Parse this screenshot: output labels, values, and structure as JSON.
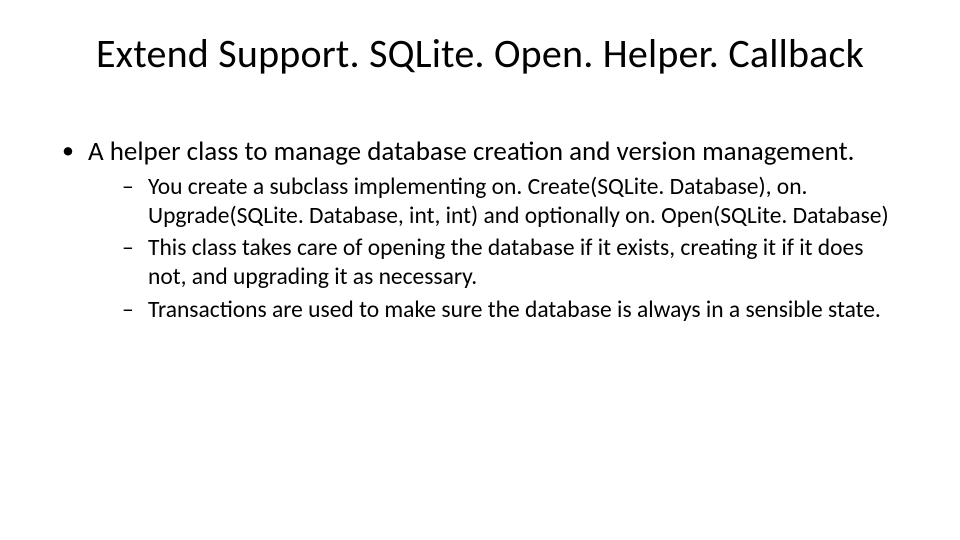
{
  "title": "Extend Support. SQLite. Open. Helper. Callback",
  "level1_text": "A helper class to manage database creation and version management.",
  "sub": [
    "You create a subclass implementing on. Create(SQLite. Database), on. Upgrade(SQLite. Database, int, int) and optionally on. Open(SQLite. Database)",
    "This class takes care of opening the database if it exists, creating it if it does not, and upgrading it as necessary.",
    "Transactions are used to make sure the database is always in a sensible state."
  ]
}
